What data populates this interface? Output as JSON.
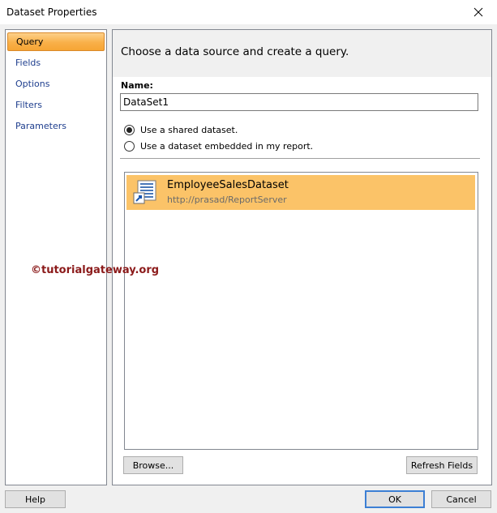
{
  "window": {
    "title": "Dataset Properties",
    "close_icon": "close-icon"
  },
  "sidebar": {
    "items": [
      {
        "label": "Query",
        "selected": true
      },
      {
        "label": "Fields",
        "selected": false
      },
      {
        "label": "Options",
        "selected": false
      },
      {
        "label": "Filters",
        "selected": false
      },
      {
        "label": "Parameters",
        "selected": false
      }
    ]
  },
  "main": {
    "header": "Choose a data source and create a query.",
    "name_label": "Name:",
    "name_value": "DataSet1",
    "radio_options": [
      {
        "label": "Use a shared dataset.",
        "checked": true
      },
      {
        "label": "Use a dataset embedded in my report.",
        "checked": false
      }
    ],
    "datasets": [
      {
        "name": "EmployeeSalesDataset",
        "url": "http://prasad/ReportServer",
        "icon": "shared-dataset-icon",
        "selected": true
      }
    ],
    "browse_label": "Browse...",
    "refresh_label": "Refresh Fields"
  },
  "footer": {
    "help_label": "Help",
    "ok_label": "OK",
    "cancel_label": "Cancel"
  },
  "watermark": "©tutorialgateway.org",
  "colors": {
    "selection": "#fbc368",
    "nav_text": "#1e3e8e",
    "watermark": "#8b1a1a",
    "default_button_border": "#3c7fd4"
  }
}
